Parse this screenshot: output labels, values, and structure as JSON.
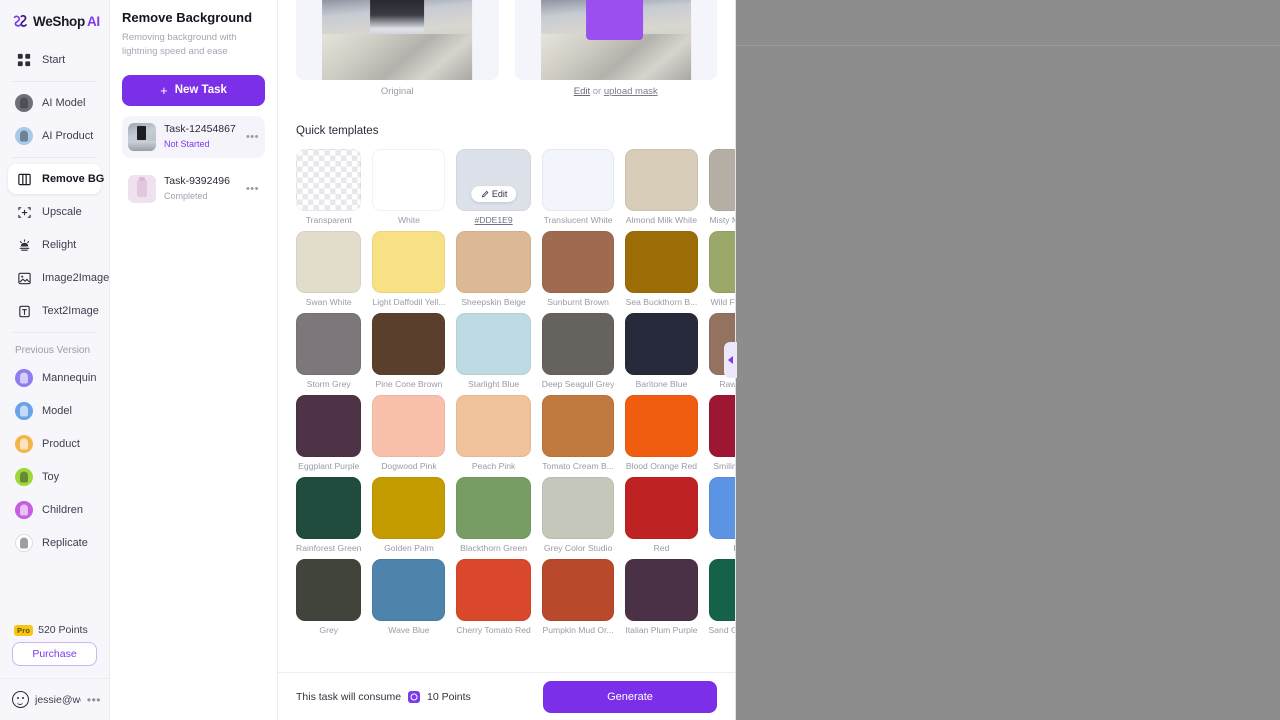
{
  "brand": {
    "name": "WeShop",
    "suffix": "AI",
    "logo_icon": "weshop-logo-icon"
  },
  "sidebar": {
    "primary": [
      {
        "label": "Start",
        "icon": "grid-icon"
      }
    ],
    "ai_group": [
      {
        "label": "AI Model",
        "icon": "ai-model-icon",
        "color": "#6f6f78"
      },
      {
        "label": "AI Product",
        "icon": "ai-product-icon",
        "color": "#a8cbe6"
      }
    ],
    "tools": [
      {
        "label": "Remove BG",
        "icon": "remove-bg-icon",
        "active": true
      },
      {
        "label": "Upscale",
        "icon": "upscale-icon",
        "active": false
      },
      {
        "label": "Relight",
        "icon": "relight-icon",
        "active": false
      },
      {
        "label": "Image2Image",
        "icon": "image2image-icon",
        "active": false
      },
      {
        "label": "Text2Image",
        "icon": "text2image-icon",
        "active": false
      }
    ],
    "previous_version_title": "Previous Version",
    "previous_version": [
      {
        "label": "Mannequin",
        "icon": "mannequin-avatar-icon",
        "color": "#8e7cf0"
      },
      {
        "label": "Model",
        "icon": "model-avatar-icon",
        "color": "#6aa3e8"
      },
      {
        "label": "Product",
        "icon": "product-avatar-icon",
        "color": "#f3b64c"
      },
      {
        "label": "Toy",
        "icon": "toy-avatar-icon",
        "color": "#9ed93a"
      },
      {
        "label": "Children",
        "icon": "children-avatar-icon",
        "color": "#c45fe0"
      },
      {
        "label": "Replicate",
        "icon": "replicate-avatar-icon",
        "color": "#ffffff"
      }
    ],
    "pro_badge": "Pro",
    "points": "520 Points",
    "purchase_label": "Purchase",
    "user_email": "jessie@we...",
    "user_menu_dots": "•••"
  },
  "tasks_panel": {
    "title": "Remove Background",
    "subtitle": "Removing background with lightning speed and ease",
    "new_task_label": "New Task",
    "new_task_plus": "+",
    "items": [
      {
        "name": "Task-12454867",
        "status": "Not Started",
        "status_type": "notstarted",
        "selected": true,
        "menu_dots": "•••"
      },
      {
        "name": "Task-9392496",
        "status": "Completed",
        "status_type": "completed",
        "selected": false,
        "menu_dots": "•••"
      }
    ]
  },
  "work": {
    "preview_original_caption": "Original",
    "preview_mask_edit": "Edit",
    "preview_mask_or": "or",
    "preview_mask_upload": "upload mask",
    "quick_templates_title": "Quick templates",
    "edit_pill_label": "Edit",
    "templates": [
      {
        "label": "Transparent",
        "color": "transparent",
        "kind": "checker"
      },
      {
        "label": "White",
        "color": "#ffffff"
      },
      {
        "label": "#DDE1E9",
        "color": "#dde1e9",
        "selected": true,
        "is_link": true
      },
      {
        "label": "Translucent White",
        "color": "#f2f5fb"
      },
      {
        "label": "Almond Milk White",
        "color": "#d7cdb8"
      },
      {
        "label": "Misty Moon Grey",
        "color": "#b5aea5"
      },
      {
        "label": "Swan White",
        "color": "#e2dccd"
      },
      {
        "label": "Light Daffodil Yell...",
        "color": "#f8e184"
      },
      {
        "label": "Sheepskin Beige",
        "color": "#ddb894"
      },
      {
        "label": "Sunburnt Brown",
        "color": "#a06a50"
      },
      {
        "label": "Sea Buckthorn B...",
        "color": "#9c6c07"
      },
      {
        "label": "Wild Fern Green",
        "color": "#9aa86a"
      },
      {
        "label": "Storm Grey",
        "color": "#7d777c"
      },
      {
        "label": "Pine Cone Brown",
        "color": "#5b3f2d"
      },
      {
        "label": "Starlight Blue",
        "color": "#bedae2"
      },
      {
        "label": "Deep Seagull Grey",
        "color": "#66625e"
      },
      {
        "label": "Baritone Blue",
        "color": "#262a3a"
      },
      {
        "label": "Raw Umber",
        "color": "#937260"
      },
      {
        "label": "Eggplant Purple",
        "color": "#4e3246"
      },
      {
        "label": "Dogwood Pink",
        "color": "#f9c0ac"
      },
      {
        "label": "Peach Pink",
        "color": "#f1c39a"
      },
      {
        "label": "Tomato Cream B...",
        "color": "#c0793f"
      },
      {
        "label": "Blood Orange Red",
        "color": "#f05c10"
      },
      {
        "label": "Smiling Scarlet",
        "color": "#9d1733"
      },
      {
        "label": "Rainforest Green",
        "color": "#204b3e"
      },
      {
        "label": "Golden Palm",
        "color": "#c49c00"
      },
      {
        "label": "Blackthorn Green",
        "color": "#779d64"
      },
      {
        "label": "Grey Color Studio",
        "color": "#c5c7ba"
      },
      {
        "label": "Red",
        "color": "#bf2222"
      },
      {
        "label": "Blue",
        "color": "#5b94e3"
      },
      {
        "label": "Grey",
        "color": "#40443a"
      },
      {
        "label": "Wave Blue",
        "color": "#4e83ab"
      },
      {
        "label": "Cherry Tomato Red",
        "color": "#d9482a"
      },
      {
        "label": "Pumpkin Mud Or...",
        "color": "#b8492a"
      },
      {
        "label": "Italian Plum Purple",
        "color": "#4b3146"
      },
      {
        "label": "Sand Gold Green",
        "color": "#156149"
      }
    ],
    "footer_consume_text": "This task will consume",
    "footer_points": "10 Points",
    "footer_coin_icon": "points-coin-icon",
    "generate_label": "Generate"
  },
  "canvas": {
    "collapse_icon": "collapse-left-icon"
  },
  "colors": {
    "accent": "#7c2fe8",
    "accent_text": "#7c3aed",
    "canvas_bg": "#8d8d8d"
  }
}
